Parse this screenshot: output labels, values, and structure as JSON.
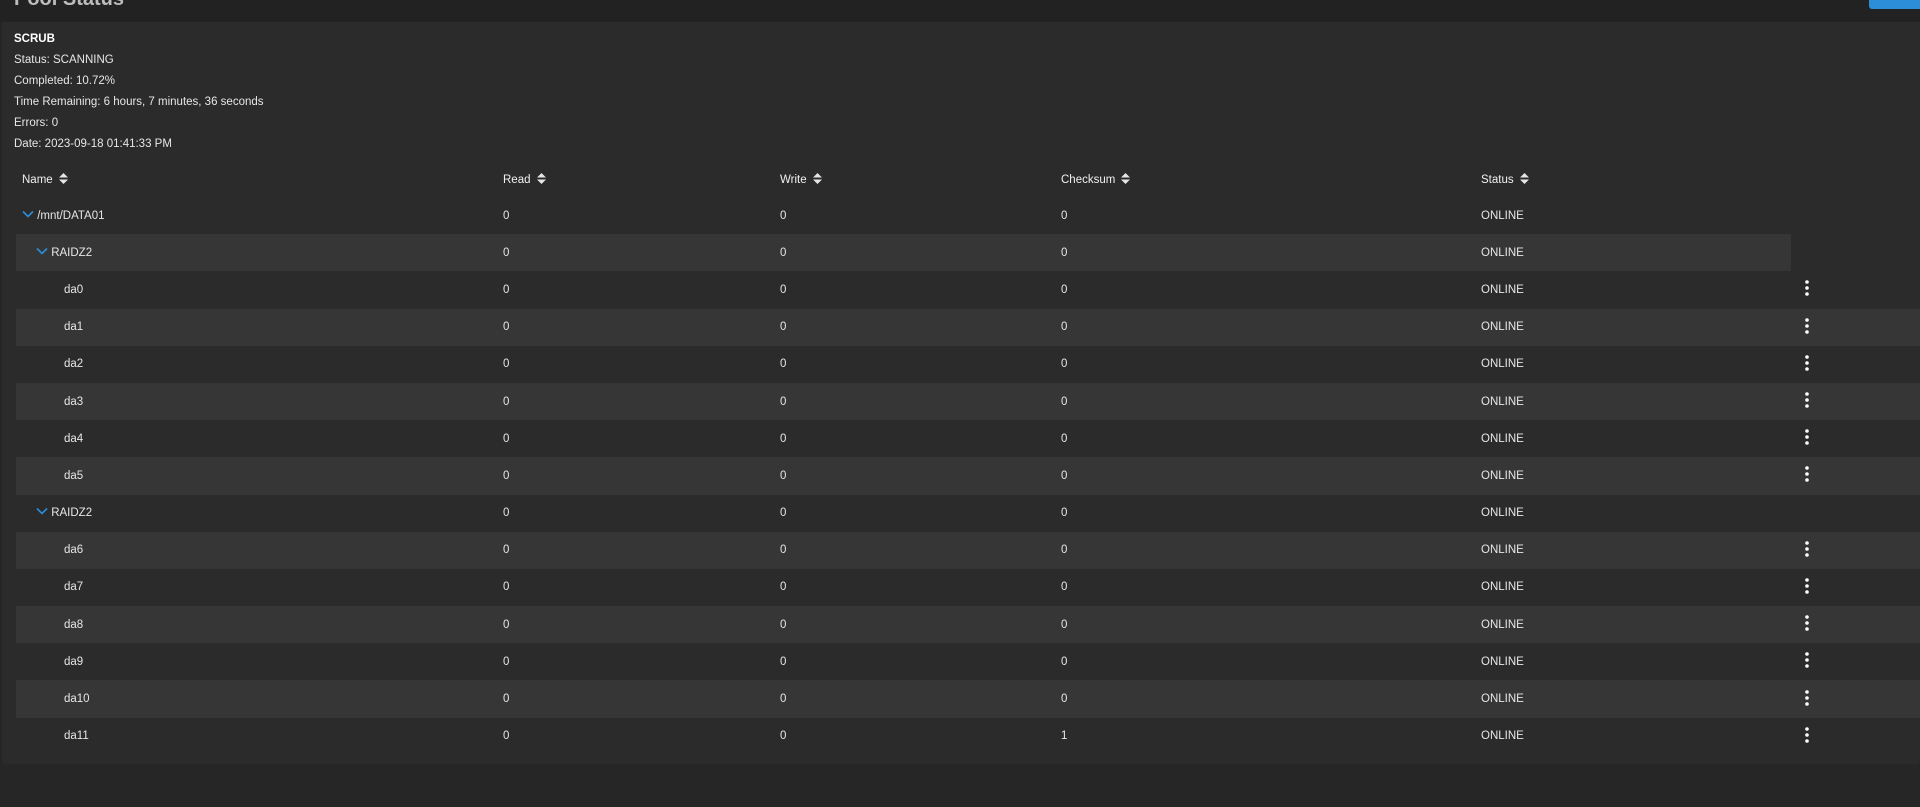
{
  "page": {
    "title_clip": "Pool Status"
  },
  "scrub": {
    "title": "SCRUB",
    "status": "Status: SCANNING",
    "completed": "Completed: 10.72%",
    "time_remaining": "Time Remaining: 6 hours, 7 minutes, 36 seconds",
    "errors": "Errors: 0",
    "date": "Date: 2023-09-18 01:41:33 PM"
  },
  "table": {
    "headers": {
      "name": "Name",
      "read": "Read",
      "write": "Write",
      "checksum": "Checksum",
      "status": "Status"
    },
    "rows": [
      {
        "name": "/mnt/DATA01",
        "read": "0",
        "write": "0",
        "checksum": "0",
        "status": "ONLINE"
      },
      {
        "name": "RAIDZ2",
        "read": "0",
        "write": "0",
        "checksum": "0",
        "status": "ONLINE"
      },
      {
        "name": "da0",
        "read": "0",
        "write": "0",
        "checksum": "0",
        "status": "ONLINE"
      },
      {
        "name": "da1",
        "read": "0",
        "write": "0",
        "checksum": "0",
        "status": "ONLINE"
      },
      {
        "name": "da2",
        "read": "0",
        "write": "0",
        "checksum": "0",
        "status": "ONLINE"
      },
      {
        "name": "da3",
        "read": "0",
        "write": "0",
        "checksum": "0",
        "status": "ONLINE"
      },
      {
        "name": "da4",
        "read": "0",
        "write": "0",
        "checksum": "0",
        "status": "ONLINE"
      },
      {
        "name": "da5",
        "read": "0",
        "write": "0",
        "checksum": "0",
        "status": "ONLINE"
      },
      {
        "name": "RAIDZ2",
        "read": "0",
        "write": "0",
        "checksum": "0",
        "status": "ONLINE"
      },
      {
        "name": "da6",
        "read": "0",
        "write": "0",
        "checksum": "0",
        "status": "ONLINE"
      },
      {
        "name": "da7",
        "read": "0",
        "write": "0",
        "checksum": "0",
        "status": "ONLINE"
      },
      {
        "name": "da8",
        "read": "0",
        "write": "0",
        "checksum": "0",
        "status": "ONLINE"
      },
      {
        "name": "da9",
        "read": "0",
        "write": "0",
        "checksum": "0",
        "status": "ONLINE"
      },
      {
        "name": "da10",
        "read": "0",
        "write": "0",
        "checksum": "0",
        "status": "ONLINE"
      },
      {
        "name": "da11",
        "read": "0",
        "write": "0",
        "checksum": "1",
        "status": "ONLINE"
      }
    ]
  },
  "icons": {
    "expand": "chevron-down-icon",
    "sort": "sort-icon",
    "actions": "more-vert-icon"
  },
  "colors": {
    "accent": "#2c8dd8",
    "background": "#262626",
    "card": "#2b2b2b",
    "row_alt": "#363636"
  }
}
